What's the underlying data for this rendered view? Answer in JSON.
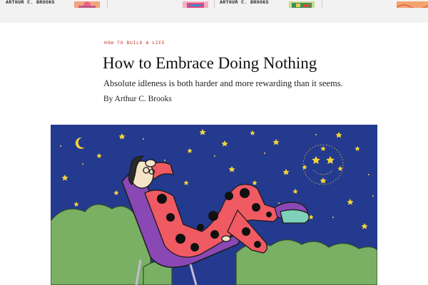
{
  "top_strip": {
    "cards": [
      {
        "author": "ARTHUR C. BROOKS"
      },
      {
        "author": "ARTHUR C. BROOKS"
      }
    ]
  },
  "article": {
    "kicker": "How to Build a Life",
    "headline": "How to Embrace Doing Nothing",
    "dek": "Absolute idleness is both harder and more rewarding than it seems.",
    "byline_prefix": "By",
    "author": "Arthur C. Brooks"
  },
  "hero": {
    "colors": {
      "sky": "#243a8f",
      "stars": "#f2d23c",
      "bushes": "#7ab064",
      "pajamas": "#f05a63",
      "dots": "#111111",
      "chair": "#8a48b5",
      "slipper": "#7fd1b9"
    }
  }
}
